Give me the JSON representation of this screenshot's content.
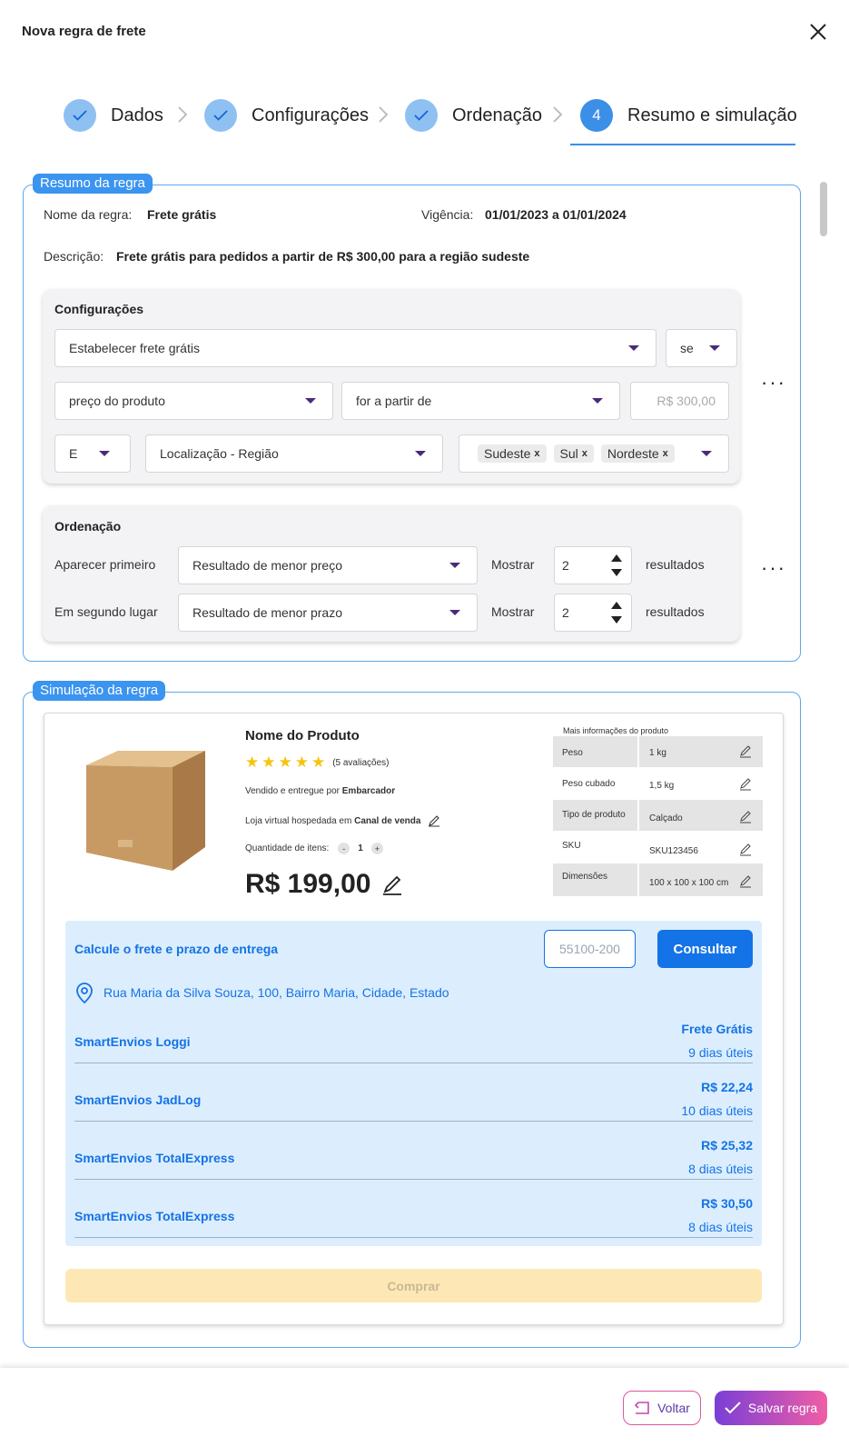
{
  "dialog": {
    "title": "Nova regra de frete",
    "close_icon": "close-icon"
  },
  "steps": [
    {
      "label": "Dados",
      "state": "done"
    },
    {
      "label": "Configurações",
      "state": "done"
    },
    {
      "label": "Ordenação",
      "state": "done"
    },
    {
      "label": "Resumo e simulação",
      "state": "active",
      "number": "4"
    }
  ],
  "summary": {
    "legend": "Resumo da regra",
    "name_label": "Nome da regra:",
    "name_value": "Frete grátis",
    "validity_label": "Vigência:",
    "validity_value": "01/01/2023 a 01/01/2024",
    "description_label": "Descrição:",
    "description_value": "Frete grátis para pedidos a partir de R$ 300,00 para a região sudeste"
  },
  "config": {
    "title": "Configurações",
    "action": "Estabelecer frete grátis",
    "condition": "se",
    "field": "preço do produto",
    "operator": "for a partir de",
    "value_placeholder": "R$ 300,00",
    "connector": "E",
    "field2": "Localização - Região",
    "regions": [
      "Sudeste",
      "Sul",
      "Nordeste"
    ],
    "chip_remove": "x",
    "more": "⋮"
  },
  "ordering": {
    "title": "Ordenação",
    "rows": [
      {
        "label": "Aparecer primeiro",
        "criteria": "Resultado de menor preço",
        "show_label": "Mostrar",
        "count": "2",
        "suffix": "resultados"
      },
      {
        "label": "Em segundo lugar",
        "criteria": "Resultado de menor prazo",
        "show_label": "Mostrar",
        "count": "2",
        "suffix": "resultados"
      }
    ]
  },
  "simulation": {
    "legend": "Simulação da regra",
    "product": {
      "name": "Nome do Produto",
      "stars": 5,
      "reviews": "(5 avaliações)",
      "sold_by_prefix": "Vendido e entregue por",
      "sold_by": "Embarcador",
      "store_prefix": "Loja virtual hospedada em",
      "store": "Canal de venda",
      "qty_label": "Quantidade de itens:",
      "qty_minus": "-",
      "qty": "1",
      "qty_plus": "+",
      "price": "R$ 199,00"
    },
    "info": {
      "title": "Mais informações do produto",
      "rows": [
        {
          "key": "Peso",
          "value": "1 kg"
        },
        {
          "key": "Peso cubado",
          "value": "1,5 kg"
        },
        {
          "key": "Tipo de produto",
          "value": "Calçado"
        },
        {
          "key": "SKU",
          "value": "SKU123456"
        },
        {
          "key": "Dimensões",
          "value": "100 x 100 x 100 cm"
        }
      ]
    },
    "shipping": {
      "title": "Calcule o frete e prazo de entrega",
      "cep_placeholder": "55100-200",
      "button": "Consultar",
      "address": "Rua Maria da Silva Souza, 100, Bairro Maria, Cidade, Estado",
      "options": [
        {
          "name": "SmartEnvios Loggi",
          "price": "Frete Grátis",
          "days": "9 dias úteis"
        },
        {
          "name": "SmartEnvios JadLog",
          "price": "R$ 22,24",
          "days": "10 dias úteis"
        },
        {
          "name": "SmartEnvios TotalExpress",
          "price": "R$ 25,32",
          "days": "8 dias úteis"
        },
        {
          "name": "SmartEnvios TotalExpress",
          "price": "R$ 30,50",
          "days": "8 dias úteis"
        }
      ]
    },
    "buy": "Comprar"
  },
  "footer": {
    "back": "Voltar",
    "save": "Salvar regra"
  },
  "colors": {
    "accent": "#1473e6",
    "step_done": "#8ec0f2",
    "step_active": "#3b8fe6",
    "buy": "#fde8b5",
    "save_from": "#7a3fd6",
    "save_to": "#f05da6"
  }
}
